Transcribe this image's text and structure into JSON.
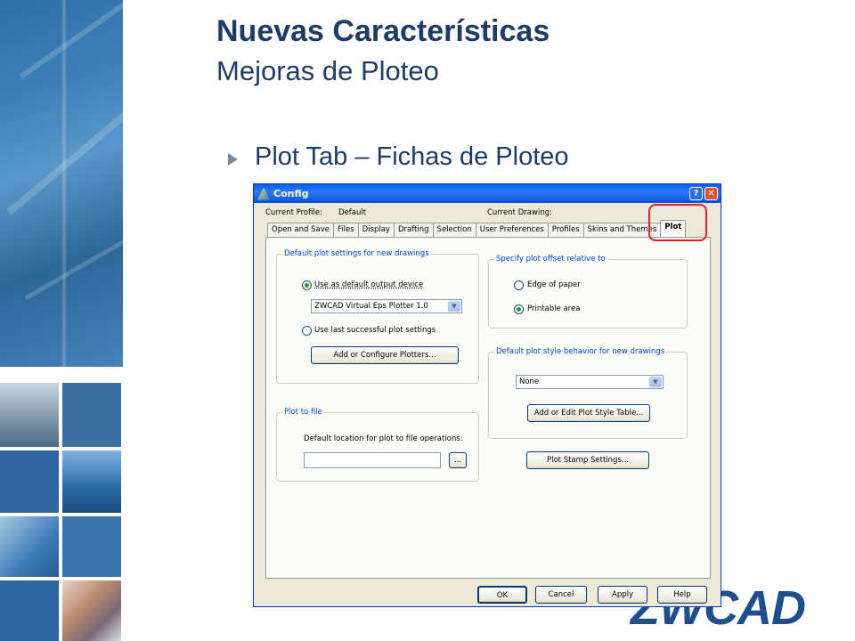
{
  "slide": {
    "title": "Nuevas Características",
    "subtitle": "Mejoras de Ploteo",
    "bullet": "Plot Tab – Fichas de Ploteo",
    "logo": "ZWCAD"
  },
  "dialog": {
    "title": "Config",
    "help_glyph": "?",
    "close_glyph": "✕",
    "current_profile_label": "Current Profile:",
    "current_profile_value": "Default",
    "current_drawing_label": "Current Drawing:",
    "tabs": [
      "Open and Save",
      "Files",
      "Display",
      "Drafting",
      "Selection",
      "User Preferences",
      "Profiles",
      "Skins and Themes",
      "Plot"
    ],
    "active_tab": "Plot",
    "default_plot": {
      "legend": "Default plot settings for new drawings",
      "use_default_label": "Use as default output device",
      "device_value": "ZWCAD Virtual Eps Plotter 1.0",
      "use_last_label": "Use last successful plot settings",
      "configure_button": "Add or Configure Plotters..."
    },
    "plot_to_file": {
      "legend": "Plot to file",
      "location_label": "Default location for plot to file operations:",
      "location_value": "",
      "browse_button": "..."
    },
    "offset": {
      "legend": "Specify plot offset relative to",
      "edge_label": "Edge of paper",
      "printable_label": "Printable area"
    },
    "style": {
      "legend": "Default plot style behavior for new drawings",
      "style_value": "None",
      "edit_button": "Add or Edit Plot Style Table..."
    },
    "stamp_button": "Plot Stamp Settings...",
    "ok_button": "OK",
    "cancel_button": "Cancel",
    "apply_button": "Apply",
    "help_button": "Help"
  },
  "colors": {
    "title_text": "#1f3c68",
    "highlight": "#e02020",
    "xp_titlebar": "#0a5ff0"
  }
}
